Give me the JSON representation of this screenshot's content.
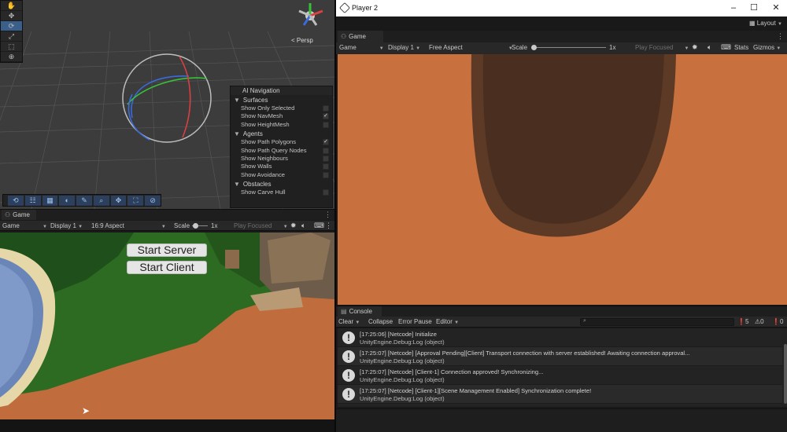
{
  "scene": {
    "tools": [
      "hand-icon",
      "move-icon",
      "rotate-icon",
      "scale-icon",
      "rect-icon",
      "transform-icon"
    ],
    "persp_label": "< Persp",
    "ai_navigation": {
      "title": "AI Navigation",
      "groups": [
        {
          "label": "Surfaces",
          "items": [
            {
              "label": "Show Only Selected",
              "checked": false
            },
            {
              "label": "Show NavMesh",
              "checked": true
            },
            {
              "label": "Show HeightMesh",
              "checked": false
            }
          ]
        },
        {
          "label": "Agents",
          "items": [
            {
              "label": "Show Path Polygons",
              "checked": true
            },
            {
              "label": "Show Path Query Nodes",
              "checked": false
            },
            {
              "label": "Show Neighbours",
              "checked": false
            },
            {
              "label": "Show Walls",
              "checked": false
            },
            {
              "label": "Show Avoidance",
              "checked": false
            }
          ]
        },
        {
          "label": "Obstacles",
          "items": [
            {
              "label": "Show Carve Hull",
              "checked": false
            }
          ]
        }
      ]
    }
  },
  "left_game": {
    "tab_label": "Game",
    "toolbar": {
      "mode": "Game",
      "display": "Display 1",
      "aspect": "16:9 Aspect",
      "scale_label": "Scale",
      "scale_value": "1x",
      "play_mode": "Play Focused"
    },
    "buttons": {
      "start_server": "Start Server",
      "start_client": "Start Client"
    }
  },
  "player2": {
    "window_title": "Player 2",
    "layout_label": "Layout",
    "tab_label": "Game",
    "toolbar": {
      "mode": "Game",
      "display": "Display 1",
      "aspect": "Free Aspect",
      "scale_label": "Scale",
      "scale_value": "1x",
      "play_mode": "Play Focused",
      "stats": "Stats",
      "gizmos": "Gizmos"
    }
  },
  "console": {
    "tab_label": "Console",
    "toolbar": {
      "clear": "Clear",
      "collapse": "Collapse",
      "error_pause": "Error Pause",
      "editor": "Editor"
    },
    "counts": {
      "log": "5",
      "warning": "0",
      "error": "0"
    },
    "logs": [
      {
        "line1": "[17:25:06] [Netcode] Initialize",
        "line2": "UnityEngine.Debug:Log (object)"
      },
      {
        "line1": "[17:25:07] [Netcode] [Approval Pending][Client] Transport connection with server established! Awaiting connection approval...",
        "line2": "UnityEngine.Debug:Log (object)"
      },
      {
        "line1": "[17:25:07] [Netcode] [Client-1] Connection approved! Synchronizing...",
        "line2": "UnityEngine.Debug:Log (object)"
      },
      {
        "line1": "[17:25:07] [Netcode] [Client-1][Scene Management Enabled] Synchronization complete!",
        "line2": "UnityEngine.Debug:Log (object)"
      }
    ]
  },
  "colors": {
    "selection_blue": "#3a5f8a",
    "ground_orange": "#c8703e",
    "forest_green": "#3c7a2c"
  }
}
